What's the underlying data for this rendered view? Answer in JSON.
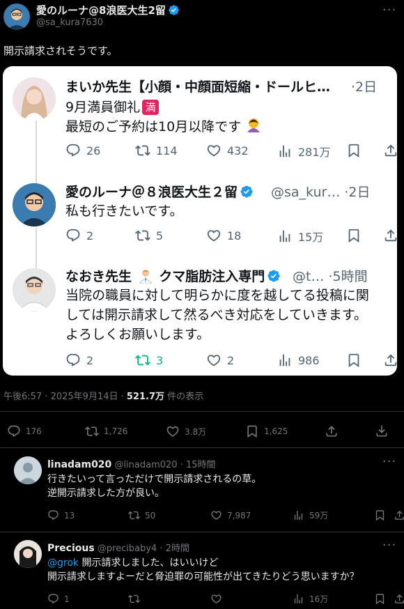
{
  "post": {
    "author_name": "愛のルーナ@8浪医大生2留",
    "author_handle": "@sa_kura7630",
    "text": "開示請求されそうです。",
    "meta_time": "午後6:57 · 2025年9月14日 · ",
    "meta_views": "521.7万",
    "meta_views_label": " 件の表示",
    "stats": {
      "replies": "176",
      "reposts": "1,726",
      "likes": "3.8万",
      "bookmarks": "1,625"
    }
  },
  "quoted": {
    "tweets": [
      {
        "name": "まいか先生【小顔・中顔面短縮・ドールヒ…",
        "time": "·2日",
        "line1": "9月満員御礼",
        "badge": "満",
        "line2": "最短のご予約は10月以降です",
        "stats": {
          "replies": "26",
          "reposts": "114",
          "likes": "432",
          "views": "281万"
        }
      },
      {
        "name": "愛のルーナ＠８浪医大生２留",
        "handle": "@sa_kur…",
        "time": "·2日",
        "text": "私も行きたいです。",
        "stats": {
          "replies": "2",
          "reposts": "5",
          "likes": "18",
          "views": "15万"
        }
      },
      {
        "name": "なおき先生",
        "name2": "クマ脂肪注入専門",
        "handle": "@t…",
        "time": "·5時間",
        "text1": "当院の職員に対して明らかに度を越してる投稿に関",
        "text2": "しては開示請求して然るべき対応をしていきます。",
        "text3": "よろしくお願いします。",
        "stats": {
          "replies": "2",
          "reposts": "3",
          "likes": "2",
          "views": "986"
        }
      }
    ]
  },
  "replies": [
    {
      "name": "linadam020",
      "handle": "@linadam020",
      "time": "· 15時間",
      "text1": "行きたいって言っただけで開示請求されるの草。",
      "text2": "逆開示請求した方が良い。",
      "stats": {
        "replies": "13",
        "reposts": "50",
        "likes": "7,987",
        "views": "59万"
      }
    },
    {
      "name": "Precious",
      "handle": "@precibaby4",
      "time": "· 2時間",
      "mention": "@grok",
      "text1": " 開示請求しました、はいいけど",
      "text2": "開示請求しますよーだと脅迫罪の可能性が出てきたりどう思いますか？",
      "stats": {
        "replies": "1",
        "views": "16万"
      }
    }
  ],
  "colors": {
    "accent": "#1d9bf0",
    "repost_active": "#00ba7c",
    "badge": "#e0245e"
  }
}
